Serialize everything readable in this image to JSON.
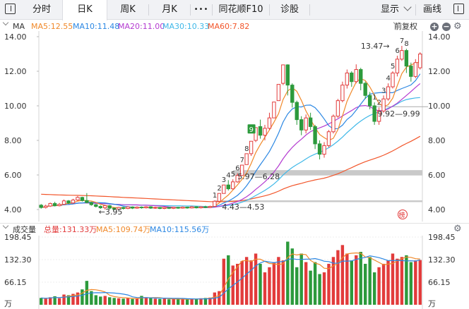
{
  "toolbar": {
    "tabs": [
      "分时",
      "日K",
      "周K",
      "月K"
    ],
    "active_tab": "日K",
    "more": "•••",
    "f10": "同花顺F10",
    "diagnose": "诊股",
    "display": "显示",
    "draw": "画线"
  },
  "ma_bar": {
    "label": "MA",
    "items": [
      {
        "text": "MA5:12.55",
        "color": "#f0892a"
      },
      {
        "text": "MA10:11.48",
        "color": "#2b87e3"
      },
      {
        "text": "MA20:11.00",
        "color": "#b43bd0"
      },
      {
        "text": "MA30:10.33",
        "color": "#3fb8e8"
      },
      {
        "text": "MA60:7.82",
        "color": "#f2552a"
      }
    ],
    "adjust": "前复权"
  },
  "vol_bar": {
    "label": "成交量",
    "items": [
      {
        "text": "总量:131.33万",
        "color": "#e23b3b"
      },
      {
        "text": "MA5:109.74万",
        "color": "#f0892a"
      },
      {
        "text": "MA10:115.56万",
        "color": "#2b87e3"
      }
    ]
  },
  "colors": {
    "up": "#e23b3b",
    "down": "#2c9a3c"
  },
  "chart_data": {
    "type": "candlestick",
    "price_ticks": [
      "14.00",
      "12.00",
      "10.00",
      "8.00",
      "6.00",
      "4.00"
    ],
    "price_ylim": [
      4.0,
      14.0
    ],
    "volume_ticks": [
      "198.45",
      "132.30",
      "66.15",
      "万"
    ],
    "volume_ylim": [
      0,
      198.45
    ],
    "volume_unit": "万",
    "annotations": {
      "high": "13.47",
      "low": "3.95",
      "gaps": [
        "5.97—6.28",
        "4.43—4.53",
        "9.92—9.99"
      ],
      "nine_turn_up": [
        "1",
        "2",
        "3",
        "4",
        "5",
        "6",
        "7",
        "8",
        "9"
      ],
      "nine_turn_top": [
        "1",
        "2",
        "3",
        "4",
        "5",
        "6",
        "7",
        "8"
      ],
      "badge": "榜"
    },
    "candles": [
      {
        "o": 4.25,
        "c": 4.12,
        "h": 4.32,
        "l": 4.05,
        "v": 20
      },
      {
        "o": 4.12,
        "c": 4.2,
        "h": 4.28,
        "l": 4.06,
        "v": 18
      },
      {
        "o": 4.2,
        "c": 4.35,
        "h": 4.4,
        "l": 4.15,
        "v": 22
      },
      {
        "o": 4.35,
        "c": 4.22,
        "h": 4.45,
        "l": 4.18,
        "v": 25
      },
      {
        "o": 4.22,
        "c": 4.3,
        "h": 4.38,
        "l": 4.18,
        "v": 19
      },
      {
        "o": 4.3,
        "c": 4.5,
        "h": 4.58,
        "l": 4.26,
        "v": 30
      },
      {
        "o": 4.5,
        "c": 4.38,
        "h": 4.55,
        "l": 4.32,
        "v": 28
      },
      {
        "o": 4.38,
        "c": 4.55,
        "h": 4.62,
        "l": 4.33,
        "v": 32
      },
      {
        "o": 4.55,
        "c": 4.7,
        "h": 4.78,
        "l": 4.5,
        "v": 36
      },
      {
        "o": 4.7,
        "c": 4.52,
        "h": 4.74,
        "l": 4.46,
        "v": 45
      },
      {
        "o": 4.52,
        "c": 4.4,
        "h": 4.95,
        "l": 4.36,
        "v": 70
      },
      {
        "o": 4.4,
        "c": 4.28,
        "h": 4.45,
        "l": 4.22,
        "v": 40
      },
      {
        "o": 4.28,
        "c": 4.18,
        "h": 4.32,
        "l": 4.12,
        "v": 28
      },
      {
        "o": 4.18,
        "c": 4.1,
        "h": 4.24,
        "l": 4.04,
        "v": 24
      },
      {
        "o": 4.1,
        "c": 4.22,
        "h": 4.26,
        "l": 4.0,
        "v": 26
      },
      {
        "o": 4.22,
        "c": 4.08,
        "h": 4.26,
        "l": 4.0,
        "v": 22
      },
      {
        "o": 4.08,
        "c": 4.02,
        "h": 4.12,
        "l": 3.95,
        "v": 20
      },
      {
        "o": 4.02,
        "c": 4.12,
        "h": 4.16,
        "l": 3.98,
        "v": 19
      },
      {
        "o": 4.12,
        "c": 4.06,
        "h": 4.16,
        "l": 4.0,
        "v": 18
      },
      {
        "o": 4.06,
        "c": 4.15,
        "h": 4.19,
        "l": 4.02,
        "v": 20
      },
      {
        "o": 4.15,
        "c": 4.08,
        "h": 4.18,
        "l": 4.03,
        "v": 17
      },
      {
        "o": 4.08,
        "c": 4.14,
        "h": 4.18,
        "l": 4.04,
        "v": 18
      },
      {
        "o": 4.14,
        "c": 4.1,
        "h": 4.18,
        "l": 4.05,
        "v": 26
      },
      {
        "o": 4.1,
        "c": 4.16,
        "h": 4.2,
        "l": 4.06,
        "v": 22
      },
      {
        "o": 4.16,
        "c": 4.08,
        "h": 4.19,
        "l": 4.04,
        "v": 20
      },
      {
        "o": 4.08,
        "c": 4.12,
        "h": 4.16,
        "l": 4.04,
        "v": 18
      },
      {
        "o": 4.12,
        "c": 4.06,
        "h": 4.15,
        "l": 4.02,
        "v": 17
      },
      {
        "o": 4.06,
        "c": 4.12,
        "h": 4.16,
        "l": 4.02,
        "v": 18
      },
      {
        "o": 4.12,
        "c": 4.07,
        "h": 4.14,
        "l": 4.03,
        "v": 16
      },
      {
        "o": 4.07,
        "c": 4.13,
        "h": 4.16,
        "l": 4.03,
        "v": 17
      },
      {
        "o": 4.13,
        "c": 4.08,
        "h": 4.16,
        "l": 4.04,
        "v": 16
      },
      {
        "o": 4.08,
        "c": 4.14,
        "h": 4.17,
        "l": 4.05,
        "v": 17
      },
      {
        "o": 4.14,
        "c": 4.09,
        "h": 4.16,
        "l": 4.05,
        "v": 16
      },
      {
        "o": 4.09,
        "c": 4.16,
        "h": 4.2,
        "l": 4.06,
        "v": 18
      },
      {
        "o": 4.16,
        "c": 4.1,
        "h": 4.19,
        "l": 4.06,
        "v": 17
      },
      {
        "o": 4.1,
        "c": 4.16,
        "h": 4.2,
        "l": 4.06,
        "v": 19
      },
      {
        "o": 4.16,
        "c": 4.12,
        "h": 4.22,
        "l": 4.08,
        "v": 20
      },
      {
        "o": 4.12,
        "c": 4.18,
        "h": 4.22,
        "l": 4.08,
        "v": 21
      },
      {
        "o": 4.18,
        "c": 4.48,
        "h": 4.53,
        "l": 4.15,
        "v": 36
      },
      {
        "o": 4.48,
        "c": 4.93,
        "h": 4.93,
        "l": 4.48,
        "v": 40
      },
      {
        "o": 4.93,
        "c": 5.42,
        "h": 5.42,
        "l": 4.93,
        "v": 135
      },
      {
        "o": 5.42,
        "c": 5.2,
        "h": 5.7,
        "l": 5.1,
        "v": 145
      },
      {
        "o": 5.2,
        "c": 5.6,
        "h": 5.75,
        "l": 5.15,
        "v": 115
      },
      {
        "o": 5.6,
        "c": 5.97,
        "h": 6.1,
        "l": 5.55,
        "v": 120
      },
      {
        "o": 5.97,
        "c": 6.57,
        "h": 6.57,
        "l": 5.97,
        "v": 128
      },
      {
        "o": 6.6,
        "c": 7.23,
        "h": 7.23,
        "l": 6.6,
        "v": 140
      },
      {
        "o": 7.23,
        "c": 7.95,
        "h": 7.95,
        "l": 7.1,
        "v": 130
      },
      {
        "o": 8.0,
        "c": 8.74,
        "h": 8.74,
        "l": 7.9,
        "v": 150
      },
      {
        "o": 8.8,
        "c": 8.3,
        "h": 9.2,
        "l": 8.1,
        "v": 120
      },
      {
        "o": 8.3,
        "c": 8.7,
        "h": 8.9,
        "l": 8.0,
        "v": 95
      },
      {
        "o": 8.7,
        "c": 9.3,
        "h": 9.6,
        "l": 8.6,
        "v": 110
      },
      {
        "o": 9.3,
        "c": 10.22,
        "h": 10.22,
        "l": 9.3,
        "v": 125
      },
      {
        "o": 10.3,
        "c": 11.24,
        "h": 11.24,
        "l": 10.3,
        "v": 140
      },
      {
        "o": 11.3,
        "c": 12.37,
        "h": 12.37,
        "l": 11.2,
        "v": 130
      },
      {
        "o": 12.37,
        "c": 11.2,
        "h": 12.4,
        "l": 10.6,
        "v": 185
      },
      {
        "o": 11.2,
        "c": 10.2,
        "h": 11.3,
        "l": 9.9,
        "v": 165
      },
      {
        "o": 10.2,
        "c": 9.2,
        "h": 10.3,
        "l": 8.9,
        "v": 110
      },
      {
        "o": 9.2,
        "c": 8.6,
        "h": 9.4,
        "l": 8.3,
        "v": 150
      },
      {
        "o": 8.6,
        "c": 9.3,
        "h": 9.5,
        "l": 8.4,
        "v": 125
      },
      {
        "o": 9.3,
        "c": 8.8,
        "h": 9.6,
        "l": 8.6,
        "v": 100
      },
      {
        "o": 8.8,
        "c": 7.8,
        "h": 8.9,
        "l": 7.5,
        "v": 125
      },
      {
        "o": 7.8,
        "c": 7.2,
        "h": 8.0,
        "l": 6.9,
        "v": 90
      },
      {
        "o": 7.2,
        "c": 7.7,
        "h": 7.9,
        "l": 7.0,
        "v": 95
      },
      {
        "o": 7.7,
        "c": 8.5,
        "h": 8.6,
        "l": 7.6,
        "v": 120
      },
      {
        "o": 8.5,
        "c": 9.4,
        "h": 9.5,
        "l": 8.4,
        "v": 140
      },
      {
        "o": 9.4,
        "c": 10.3,
        "h": 10.4,
        "l": 9.3,
        "v": 160
      },
      {
        "o": 10.3,
        "c": 11.2,
        "h": 11.4,
        "l": 10.2,
        "v": 175
      },
      {
        "o": 11.2,
        "c": 11.9,
        "h": 12.1,
        "l": 11.0,
        "v": 150
      },
      {
        "o": 11.9,
        "c": 11.4,
        "h": 12.0,
        "l": 11.1,
        "v": 130
      },
      {
        "o": 11.4,
        "c": 12.1,
        "h": 12.4,
        "l": 11.3,
        "v": 145
      },
      {
        "o": 12.1,
        "c": 11.3,
        "h": 12.2,
        "l": 10.9,
        "v": 155
      },
      {
        "o": 11.3,
        "c": 10.6,
        "h": 11.4,
        "l": 10.4,
        "v": 120
      },
      {
        "o": 10.6,
        "c": 10.0,
        "h": 10.8,
        "l": 9.8,
        "v": 140
      },
      {
        "o": 10.0,
        "c": 9.1,
        "h": 10.2,
        "l": 8.9,
        "v": 95
      },
      {
        "o": 9.1,
        "c": 9.7,
        "h": 9.9,
        "l": 8.9,
        "v": 110
      },
      {
        "o": 9.7,
        "c": 10.4,
        "h": 10.6,
        "l": 9.6,
        "v": 120
      },
      {
        "o": 10.4,
        "c": 11.1,
        "h": 11.3,
        "l": 10.3,
        "v": 130
      },
      {
        "o": 11.1,
        "c": 11.9,
        "h": 12.0,
        "l": 11.0,
        "v": 150
      },
      {
        "o": 11.9,
        "c": 12.7,
        "h": 12.9,
        "l": 11.7,
        "v": 135
      },
      {
        "o": 12.7,
        "c": 13.2,
        "h": 13.47,
        "l": 12.6,
        "v": 140
      },
      {
        "o": 13.2,
        "c": 12.3,
        "h": 13.3,
        "l": 11.9,
        "v": 145
      },
      {
        "o": 12.3,
        "c": 11.7,
        "h": 12.5,
        "l": 11.4,
        "v": 125
      },
      {
        "o": 11.7,
        "c": 12.5,
        "h": 12.7,
        "l": 11.6,
        "v": 130
      },
      {
        "o": 12.2,
        "c": 13.0,
        "h": 13.1,
        "l": 12.1,
        "v": 131
      }
    ]
  }
}
